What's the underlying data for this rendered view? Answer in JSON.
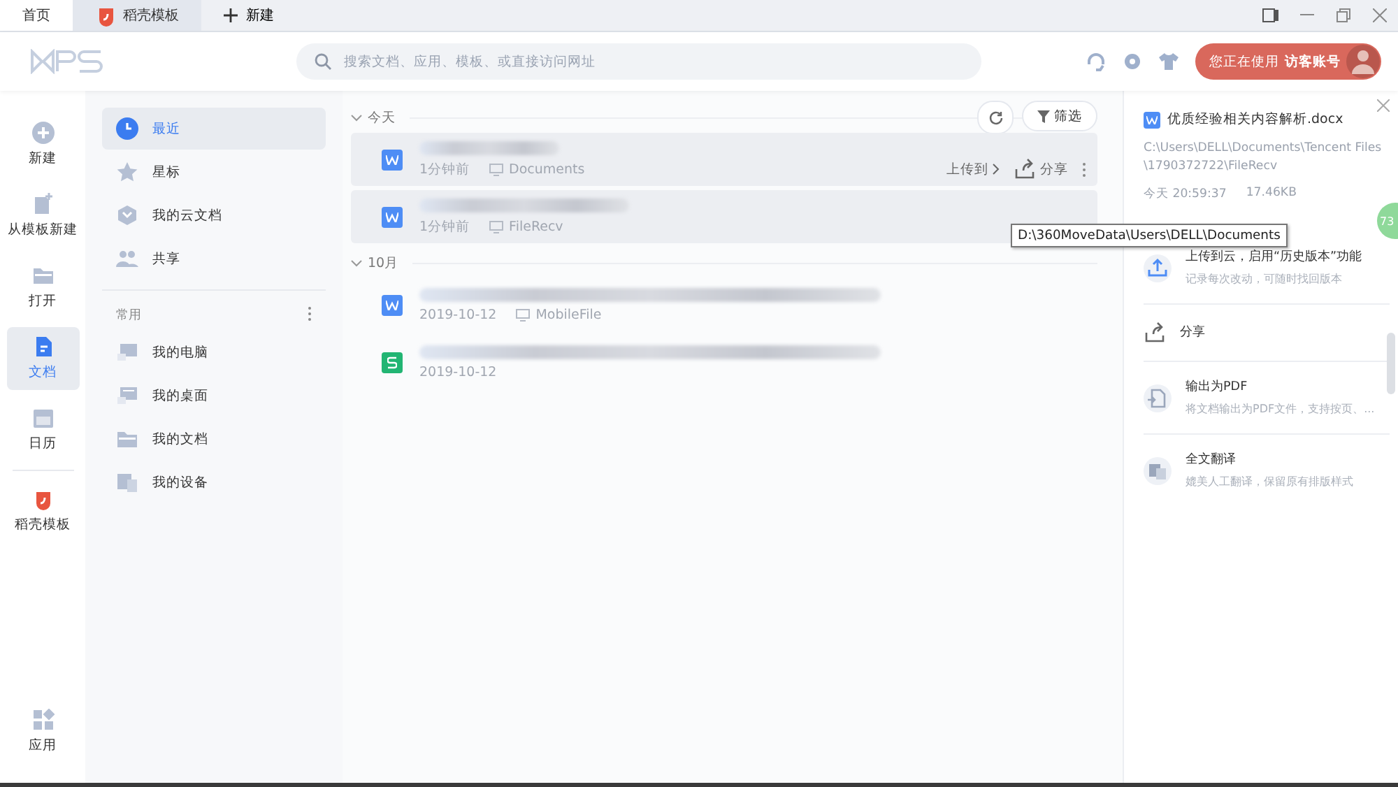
{
  "tabs": [
    {
      "label": "首页",
      "kind": "home",
      "selected": true
    },
    {
      "label": "稻壳模板",
      "kind": "daoke",
      "selected": false
    }
  ],
  "new_tab": {
    "label": "新建"
  },
  "search": {
    "placeholder": "搜索文档、应用、模板、或直接访问网址"
  },
  "account": {
    "prefix": "您正在使用",
    "name": "访客账号"
  },
  "rail": [
    {
      "label": "新建",
      "kind": "plus",
      "selected": false
    },
    {
      "label": "从模板新建",
      "kind": "template",
      "selected": false
    },
    {
      "label": "打开",
      "kind": "folder",
      "selected": false
    },
    {
      "label": "文档",
      "kind": "doc",
      "selected": true
    },
    {
      "label": "日历",
      "kind": "calendar",
      "selected": false
    },
    {
      "label": "稻壳模板",
      "kind": "daoke",
      "selected": false
    }
  ],
  "rail_bottom": {
    "label": "应用"
  },
  "nav": [
    {
      "label": "最近",
      "kind": "clock",
      "selected": true
    },
    {
      "label": "星标",
      "kind": "star",
      "selected": false
    },
    {
      "label": "我的云文档",
      "kind": "cloud",
      "selected": false
    },
    {
      "label": "共享",
      "kind": "people",
      "selected": false
    }
  ],
  "common": {
    "title": "常用",
    "items": [
      {
        "label": "我的电脑",
        "kind": "pc"
      },
      {
        "label": "我的桌面",
        "kind": "desktop"
      },
      {
        "label": "我的文档",
        "kind": "folder"
      },
      {
        "label": "我的设备",
        "kind": "device"
      }
    ]
  },
  "filter_button": {
    "label": "筛选"
  },
  "groups": [
    {
      "title": "今天",
      "files": [
        {
          "kind": "writer",
          "time": "1分钟前",
          "location": "Documents",
          "selected": true,
          "upload": "上传到",
          "share": "分享"
        },
        {
          "kind": "writer",
          "time": "1分钟前",
          "location": "FileRecv",
          "selected": true
        }
      ]
    },
    {
      "title": "10月",
      "files": [
        {
          "kind": "writer",
          "time": "2019-10-12",
          "location": "MobileFile",
          "selected": false
        },
        {
          "kind": "spreadsheet",
          "time": "2019-10-12",
          "selected": false
        }
      ]
    }
  ],
  "tooltip": "D:\\360MoveData\\Users\\DELL\\Documents",
  "detail": {
    "file_name": "优质经验相关内容解析.docx",
    "path": "C:\\Users\\DELL\\Documents\\Tencent Files\\1790372722\\FileRecv",
    "date": "今天 20:59:37",
    "size": "17.46KB",
    "actions": [
      {
        "kind": "upload",
        "title": "上传到云，启用“历史版本”功能",
        "desc": "记录每次改动，可随时找回版本"
      },
      {
        "kind": "share",
        "title": "分享"
      },
      {
        "kind": "pdf",
        "title": "输出为PDF",
        "desc": "将文档输出为PDF文件，支持按页、..."
      },
      {
        "kind": "translate",
        "title": "全文翻译",
        "desc": "媲美人工翻译，保留原有排版样式"
      }
    ]
  },
  "float_ball": "73"
}
